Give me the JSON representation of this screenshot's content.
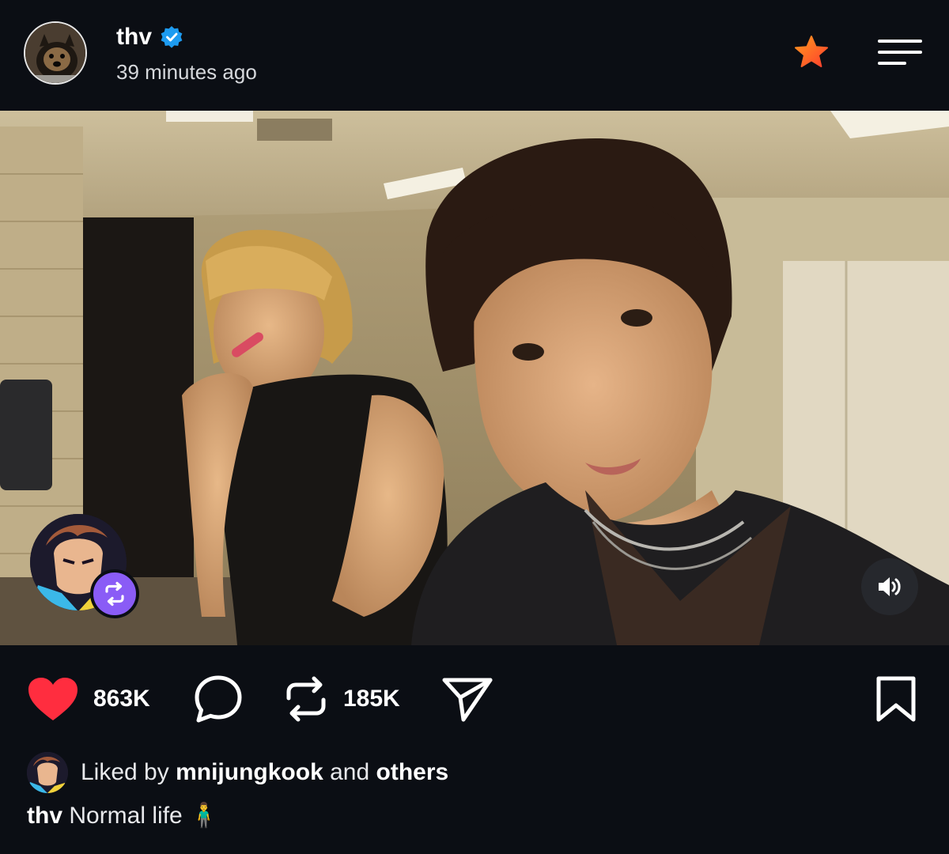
{
  "post": {
    "author": {
      "username": "thv",
      "verified": true,
      "avatar_icon": "dog-avatar"
    },
    "timestamp": "39 minutes ago",
    "header_actions": {
      "star_icon": "star-icon",
      "menu_icon": "menu-icon"
    },
    "media": {
      "type": "video",
      "collab_avatar_icon": "cartoon-avatar",
      "repost_badge_icon": "repost-icon",
      "sound_icon": "speaker-icon"
    },
    "actions": {
      "like_count": "863K",
      "repost_count": "185K",
      "like_icon": "heart-icon",
      "comment_icon": "comment-icon",
      "repost_icon": "repost-icon",
      "share_icon": "send-icon",
      "save_icon": "bookmark-icon"
    },
    "likes": {
      "prefix": "Liked by",
      "user": "mnijungkook",
      "conjunction": "and",
      "suffix": "others"
    },
    "caption": {
      "username": "thv",
      "text": "Normal life",
      "emoji": "🧍‍♂️"
    }
  },
  "colors": {
    "background": "#0b0e14",
    "like_red": "#ff2d3f",
    "verified_blue": "#1d9bf0",
    "star_gradient_start": "#ff8a1e",
    "star_gradient_end": "#ff3d2e",
    "repost_badge": "#8a5cf6"
  }
}
